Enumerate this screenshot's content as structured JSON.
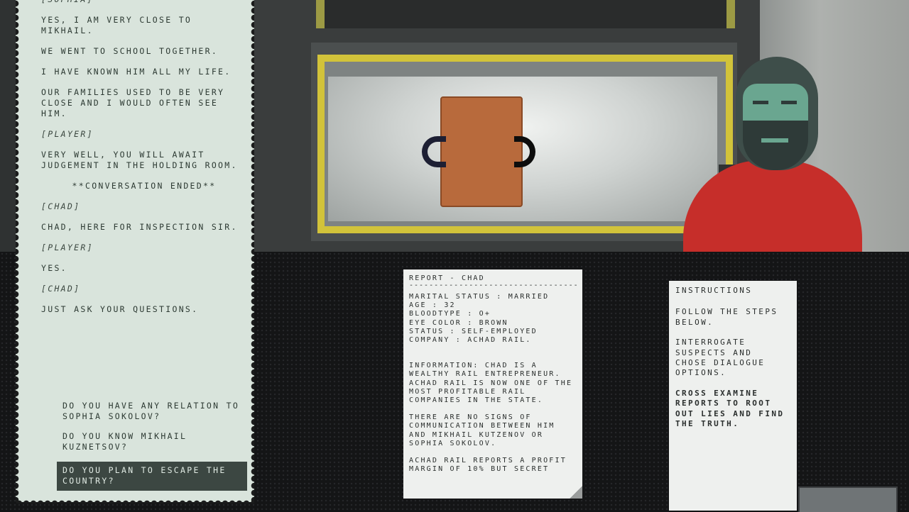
{
  "dialogue_log": [
    {
      "text": "[SOPHIA]",
      "style": "speaker"
    },
    {
      "text": "YES, I AM VERY CLOSE TO MIKHAIL.",
      "style": "line"
    },
    {
      "text": "WE WENT TO SCHOOL TOGETHER.",
      "style": "line"
    },
    {
      "text": "I HAVE KNOWN HIM ALL MY LIFE.",
      "style": "line"
    },
    {
      "text": "OUR FAMILIES USED TO BE VERY CLOSE AND I WOULD OFTEN SEE HIM.",
      "style": "line"
    },
    {
      "text": "[PLAYER]",
      "style": "speaker"
    },
    {
      "text": "VERY WELL, YOU WILL AWAIT JUDGEMENT IN THE HOLDING ROOM.",
      "style": "line"
    },
    {
      "text": "**CONVERSATION ENDED**",
      "style": "center"
    },
    {
      "text": "[CHAD]",
      "style": "speaker"
    },
    {
      "text": "CHAD, HERE FOR INSPECTION SIR.",
      "style": "line"
    },
    {
      "text": "[PLAYER]",
      "style": "speaker"
    },
    {
      "text": "YES.",
      "style": "line"
    },
    {
      "text": "[CHAD]",
      "style": "speaker"
    },
    {
      "text": "JUST ASK YOUR QUESTIONS.",
      "style": "line"
    }
  ],
  "dialogue_options": [
    {
      "text": "DO YOU HAVE ANY RELATION TO SOPHIA SOKOLOV?",
      "selected": false
    },
    {
      "text": "DO YOU KNOW MIKHAIL KUZNETSOV?",
      "selected": false
    },
    {
      "text": "DO YOU PLAN TO ESCAPE THE COUNTRY?",
      "selected": true
    }
  ],
  "report": {
    "title": "REPORT - CHAD",
    "rule": "------------------------------------------",
    "facts": [
      "MARITAL STATUS : MARRIED",
      "AGE : 32",
      "BLOODTYPE : O+",
      "EYE COLOR : BROWN",
      "STATUS : SELF-EMPLOYED",
      "COMPANY : ACHAD RAIL."
    ],
    "paragraphs": [
      "INFORMATION: CHAD IS A WEALTHY RAIL ENTREPRENEUR. ACHAD RAIL IS NOW ONE OF THE MOST PROFITABLE RAIL COMPANIES IN THE STATE.",
      "THERE ARE NO SIGNS OF COMMUNICATION BETWEEN HIM AND MIKHAIL KUTZENOV OR SOPHIA SOKOLOV.",
      "ACHAD RAIL REPORTS A PROFIT MARGIN OF 10% BUT SECRET"
    ]
  },
  "instructions": {
    "heading": "INSTRUCTIONS",
    "steps": [
      {
        "text": "FOLLOW THE STEPS BELOW.",
        "bold": false
      },
      {
        "text": "INTERROGATE SUSPECTS AND CHOSE DIALOGUE OPTIONS.",
        "bold": false
      },
      {
        "text": "CROSS EXAMINE REPORTS TO ROOT OUT LIES AND FIND THE TRUTH.",
        "bold": true
      }
    ]
  },
  "colors": {
    "log_paper": "#d9e4dc",
    "option_selected_bg": "#3c4742",
    "report_paper": "#eef0ee",
    "suspect_shirt": "#c62e2a",
    "suspect_skin": "#6aa690",
    "table_trim": "#d2c33a"
  },
  "icons": {
    "report_corner": "page-curl-icon"
  }
}
